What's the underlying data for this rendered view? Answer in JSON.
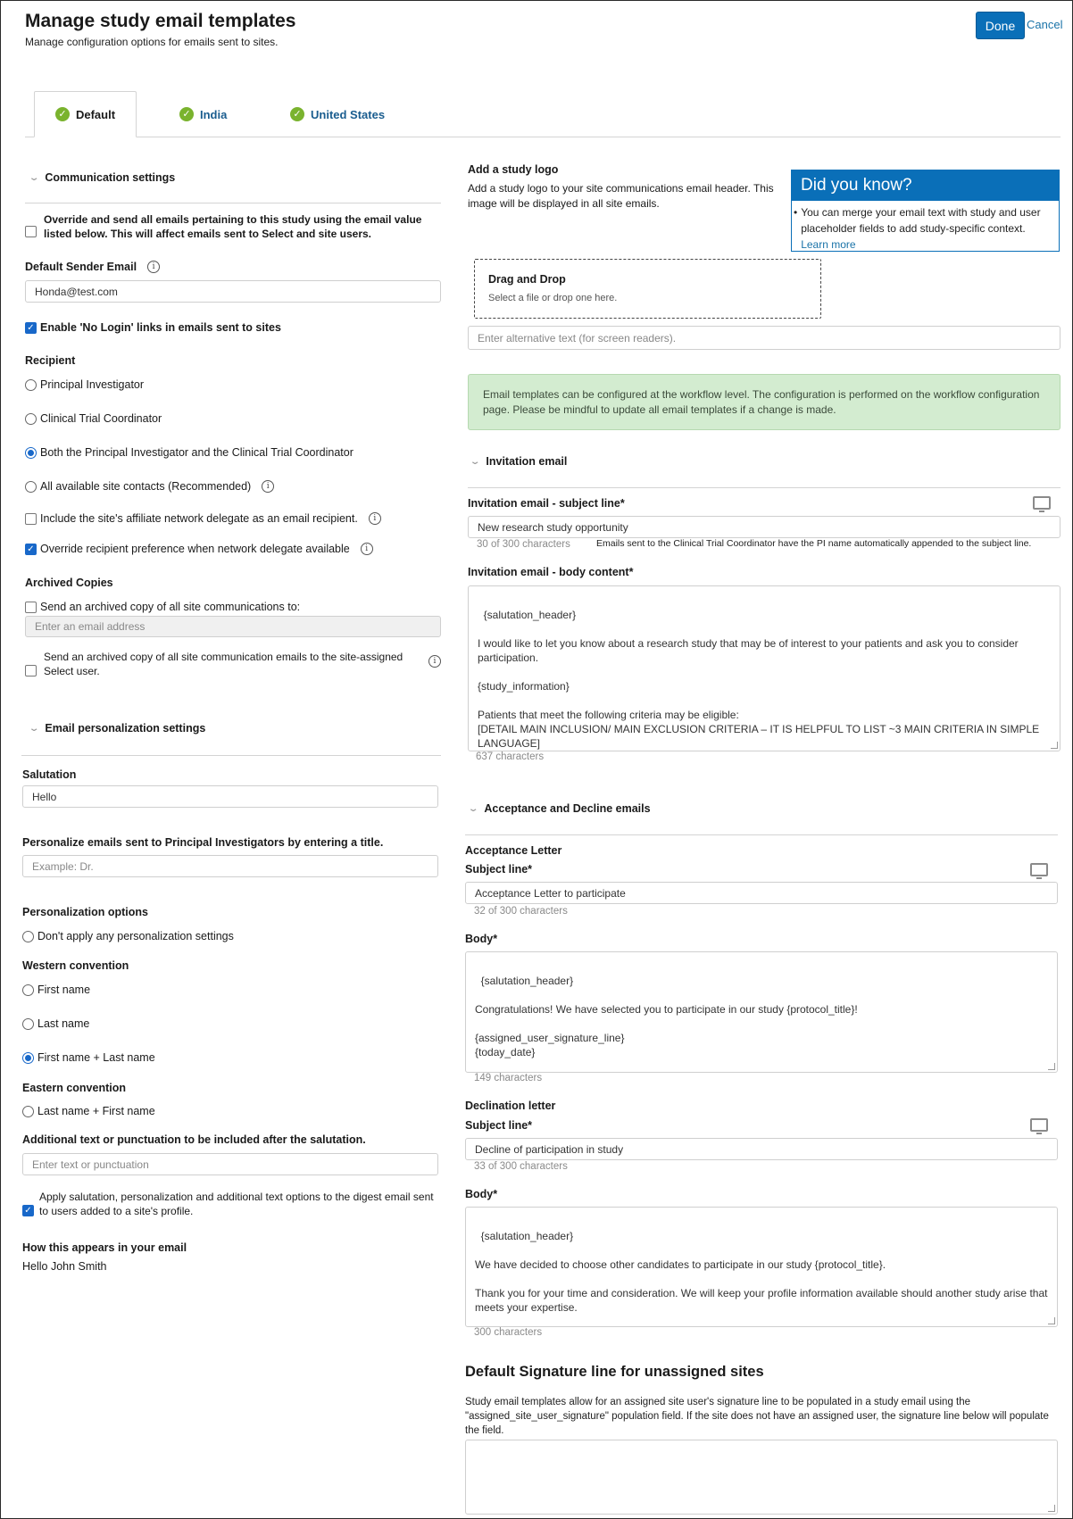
{
  "header": {
    "title": "Manage study email templates",
    "subtitle": "Manage configuration options for emails sent to sites.",
    "done_label": "Done",
    "cancel_label": "Cancel"
  },
  "tabs": [
    {
      "label": "Default",
      "active": true
    },
    {
      "label": "India",
      "active": false
    },
    {
      "label": "United States",
      "active": false
    }
  ],
  "communication": {
    "heading": "Communication settings",
    "override_label": "Override and send all emails pertaining to this study using the email value listed below. This will affect emails sent to Select and site users.",
    "override_checked": false,
    "sender_label": "Default Sender Email",
    "sender_value": "Honda@test.com",
    "no_login_label": "Enable 'No Login' links in emails sent to sites",
    "no_login_checked": true,
    "recipient_heading": "Recipient",
    "recipients": [
      {
        "label": "Principal Investigator",
        "selected": false
      },
      {
        "label": "Clinical Trial Coordinator",
        "selected": false
      },
      {
        "label": "Both the Principal Investigator and the Clinical Trial Coordinator",
        "selected": true
      },
      {
        "label": "All available site contacts (Recommended)",
        "selected": false
      }
    ],
    "affiliate_label": "Include the site's affiliate network delegate as an email recipient.",
    "affiliate_checked": false,
    "override_pref_label": "Override recipient preference when network delegate available",
    "override_pref_checked": true,
    "archived_heading": "Archived Copies",
    "archived_send_label": "Send an archived copy of all site communications to:",
    "archived_email_placeholder": "Enter an email address",
    "archived_select_label": "Send an archived copy of all site communication emails to the site-assigned Select user."
  },
  "personalization": {
    "heading": "Email personalization settings",
    "salutation_label": "Salutation",
    "salutation_value": "Hello",
    "pi_title_label": "Personalize emails sent to Principal Investigators by entering a title.",
    "pi_title_placeholder": "Example: Dr.",
    "options_heading": "Personalization options",
    "dont_apply_label": "Don't apply any personalization settings",
    "western_heading": "Western convention",
    "first_name_label": "First name",
    "last_name_label": "Last name",
    "first_last_label": "First name + Last name",
    "eastern_heading": "Eastern convention",
    "last_first_label": "Last name + First name",
    "additional_label": "Additional text or punctuation to be included after the salutation.",
    "additional_placeholder": "Enter text or punctuation",
    "apply_digest_label": "Apply salutation, personalization and additional text options to the digest email sent to users added to a site's profile.",
    "appears_heading": "How this appears in your email",
    "appears_value": "Hello John Smith"
  },
  "logo": {
    "heading": "Add a study logo",
    "description": "Add a study logo to your site communications email header. This image will be displayed in all site emails.",
    "drop_title": "Drag and Drop",
    "drop_hint": "Select a file or drop one here.",
    "alt_placeholder": "Enter alternative text (for screen readers)."
  },
  "did_you_know": {
    "title": "Did you know?",
    "text": "You can merge your email text with study and user placeholder fields to add study-specific context.",
    "link": "Learn more"
  },
  "workflow_notice": "Email templates can be configured at the workflow level. The configuration is performed on the workflow configuration page. Please be mindful to update all email templates if a change is made.",
  "invitation": {
    "heading": "Invitation email",
    "subject_label": "Invitation email - subject line*",
    "subject_value": "New research study opportunity",
    "subject_count": "30 of 300 characters",
    "subject_note": "Emails sent to the Clinical Trial Coordinator have the PI name automatically appended to the subject line.",
    "body_label": "Invitation email - body content*",
    "body_value": "{salutation_header}\n\nI would like to let you know about a research study that may be of interest to your patients and ask you to consider participation.\n\n{study_information}\n\nPatients that meet the following criteria may be eligible:\n[DETAIL MAIN INCLUSION/ MAIN EXCLUSION CRITERIA – IT IS HELPFUL TO LIST ~3 MAIN CRITERIA IN SIMPLE LANGUAGE]",
    "body_count": "637 characters"
  },
  "acceptance": {
    "heading": "Acceptance and Decline emails",
    "accept_heading": "Acceptance Letter",
    "accept_subject_label": "Subject line*",
    "accept_subject_value": "Acceptance Letter to participate",
    "accept_subject_count": "32 of 300 characters",
    "accept_body_label": "Body*",
    "accept_body_value": "{salutation_header}\n\nCongratulations! We have selected you to participate in our study {protocol_title}!\n\n{assigned_user_signature_line}\n{today_date}",
    "accept_body_count": "149 characters",
    "decline_heading": "Declination letter",
    "decline_subject_label": "Subject line*",
    "decline_subject_value": "Decline of participation in study",
    "decline_subject_count": "33 of 300 characters",
    "decline_body_label": "Body*",
    "decline_body_value": "{salutation_header}\n\nWe have decided to choose other candidates to participate in our study {protocol_title}.\n\nThank you for your time and consideration. We will keep your profile information available should another study arise that meets your expertise.\n\n{assigned_user_signature_line}",
    "decline_body_count": "300 characters"
  },
  "signature": {
    "heading": "Default Signature line for unassigned sites",
    "description": "Study email templates allow for an assigned site user's signature line to be populated in a study email using the \"assigned_site_user_signature\" population field. If the site does not have an assigned user, the signature line below will populate the field."
  },
  "colors": {
    "accent": "#0a6fb8",
    "success": "#7ab32e",
    "notice_bg": "#d3ecd0"
  }
}
